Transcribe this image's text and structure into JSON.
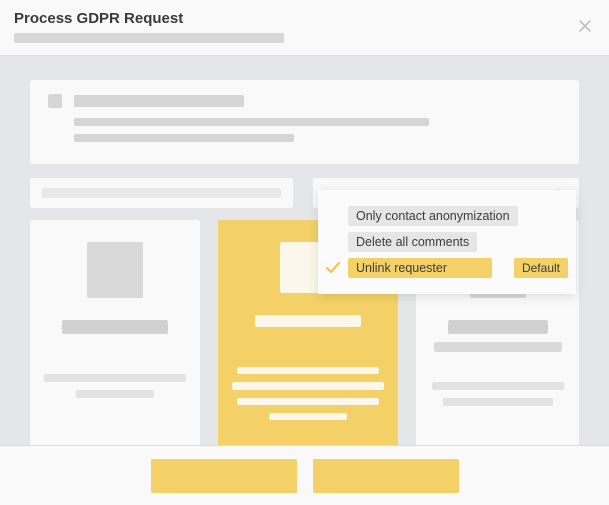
{
  "header": {
    "title": "Process GDPR Request"
  },
  "dropdown": {
    "options": [
      {
        "label": "Only contact anonymization"
      },
      {
        "label": "Delete all comments"
      },
      {
        "label": "Unlink requester",
        "selected": true,
        "default_label": "Default"
      }
    ]
  }
}
